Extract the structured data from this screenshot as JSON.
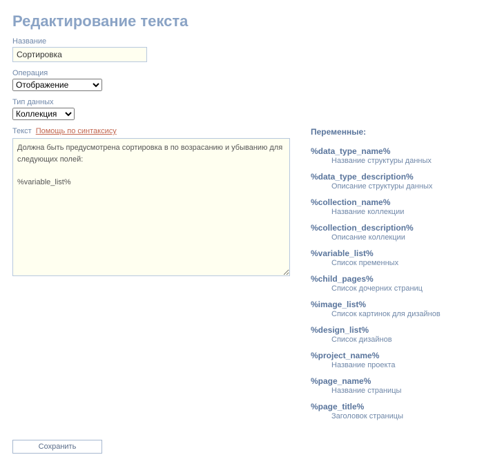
{
  "title": "Редактирование текста",
  "labels": {
    "name": "Название",
    "operation": "Операция",
    "data_type": "Тип данных",
    "text": "Текст",
    "help": "Помощь по синтаксису"
  },
  "fields": {
    "name_value": "Сортировка",
    "operation_value": "Отображение",
    "data_type_value": "Коллекция",
    "body_text": "Должна быть предусмотрена сортировка в по возрасанию и убыванию для следующих полей:\n\n%variable_list%"
  },
  "variables_title": "Переменные:",
  "variables": [
    {
      "key": "%data_type_name%",
      "desc": "Название структуры данных"
    },
    {
      "key": "%data_type_description%",
      "desc": "Описание структуры данных"
    },
    {
      "key": "%collection_name%",
      "desc": "Название коллекции"
    },
    {
      "key": "%collection_description%",
      "desc": "Описание коллекции"
    },
    {
      "key": "%variable_list%",
      "desc": "Список пременных"
    },
    {
      "key": "%child_pages%",
      "desc": "Список дочерних страниц"
    },
    {
      "key": "%image_list%",
      "desc": "Список картинок для дизайнов"
    },
    {
      "key": "%design_list%",
      "desc": "Список дизайнов"
    },
    {
      "key": "%project_name%",
      "desc": "Название проекта"
    },
    {
      "key": "%page_name%",
      "desc": "Название страницы"
    },
    {
      "key": "%page_title%",
      "desc": "Заголовок страницы"
    }
  ],
  "buttons": {
    "save": "Сохранить"
  }
}
